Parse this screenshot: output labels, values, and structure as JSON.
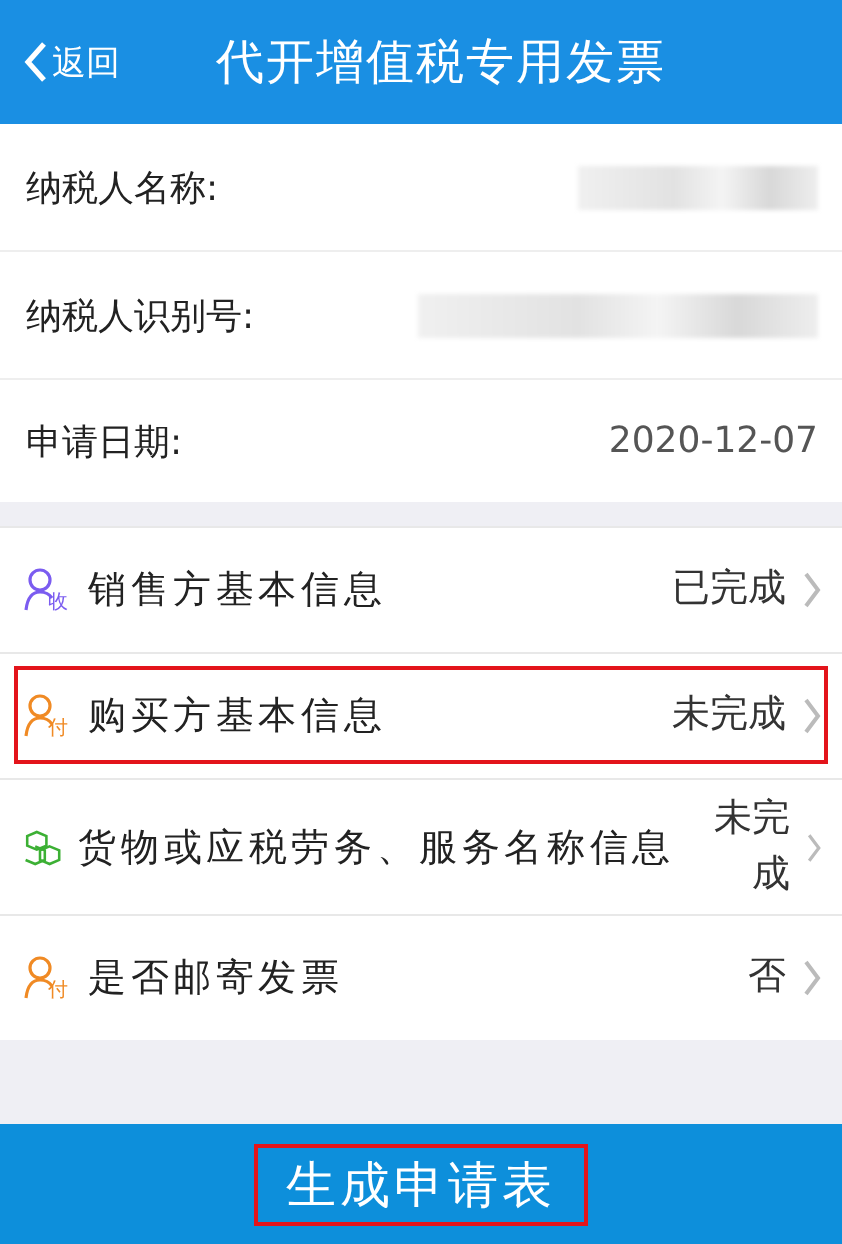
{
  "header": {
    "back": "返回",
    "title": "代开增值税专用发票"
  },
  "info_rows": [
    {
      "label": "纳税人名称:",
      "kind": "redacted"
    },
    {
      "label": "纳税人识别号:",
      "kind": "redacted"
    },
    {
      "label": "申请日期:",
      "kind": "text",
      "value": "2020-12-07"
    }
  ],
  "sections": [
    {
      "kind": "person",
      "badge": "收",
      "color": "#7b5cf0",
      "label": "销售方基本信息",
      "status": "已完成",
      "highlighted": false
    },
    {
      "kind": "person",
      "badge": "付",
      "color": "#f08a24",
      "label": "购买方基本信息",
      "status": "未完成",
      "highlighted": true
    },
    {
      "kind": "boxes",
      "color": "#3cb034",
      "label": "货物或应税劳务、服务名称信息",
      "status": "未完成",
      "highlighted": false
    },
    {
      "kind": "person",
      "badge": "付",
      "color": "#f08a24",
      "label": "是否邮寄发票",
      "status": "否",
      "highlighted": false
    }
  ],
  "submit": {
    "label": "生成申请表",
    "highlighted": true
  }
}
